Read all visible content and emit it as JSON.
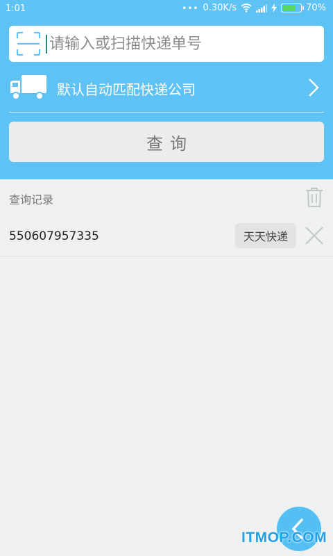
{
  "status_bar": {
    "time": "1:01",
    "network_speed": "0.30K/s",
    "battery_percent": "70%",
    "battery_level": 0.7,
    "icons": [
      "more-dots-icon",
      "wifi-icon",
      "signal-icon",
      "charging-icon",
      "battery-icon"
    ]
  },
  "search": {
    "placeholder": "请输入或扫描快递单号",
    "value": "",
    "icon": "scan-icon"
  },
  "company": {
    "label": "默认自动匹配快递公司",
    "icon": "truck-icon"
  },
  "query_button": {
    "label": "查询"
  },
  "history": {
    "title": "查询记录",
    "records": [
      {
        "number": "550607957335",
        "carrier": "天天快递"
      }
    ]
  },
  "watermark": {
    "text": "ITMOP.COM"
  },
  "colors": {
    "header_bg": "#5ec3f4",
    "page_bg": "#eff1f0",
    "fab_bg": "#53bff2",
    "watermark": "#1fa0e8"
  }
}
